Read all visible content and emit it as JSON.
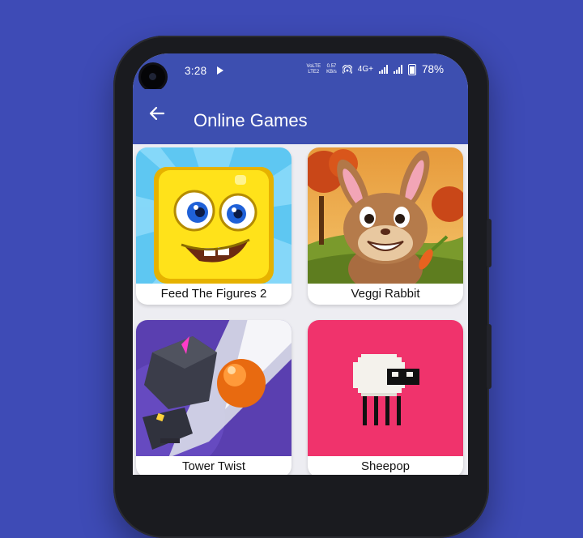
{
  "status_bar": {
    "time": "3:28",
    "volte_line1": "VoLTE",
    "volte_line2": "LTE2",
    "speed_value": "0.57",
    "speed_unit": "KB/s",
    "network": "4G+",
    "battery": "78%"
  },
  "app_bar": {
    "title": "Online Games"
  },
  "games": [
    {
      "name": "Feed The Figures 2"
    },
    {
      "name": "Veggi Rabbit"
    },
    {
      "name": "Tower Twist"
    },
    {
      "name": "Sheepop"
    }
  ],
  "colors": {
    "background": "#3e4bb6",
    "app_bar": "#3d4fb0",
    "screen_bg": "#ededf2",
    "sheepop_bg": "#f0336c"
  }
}
